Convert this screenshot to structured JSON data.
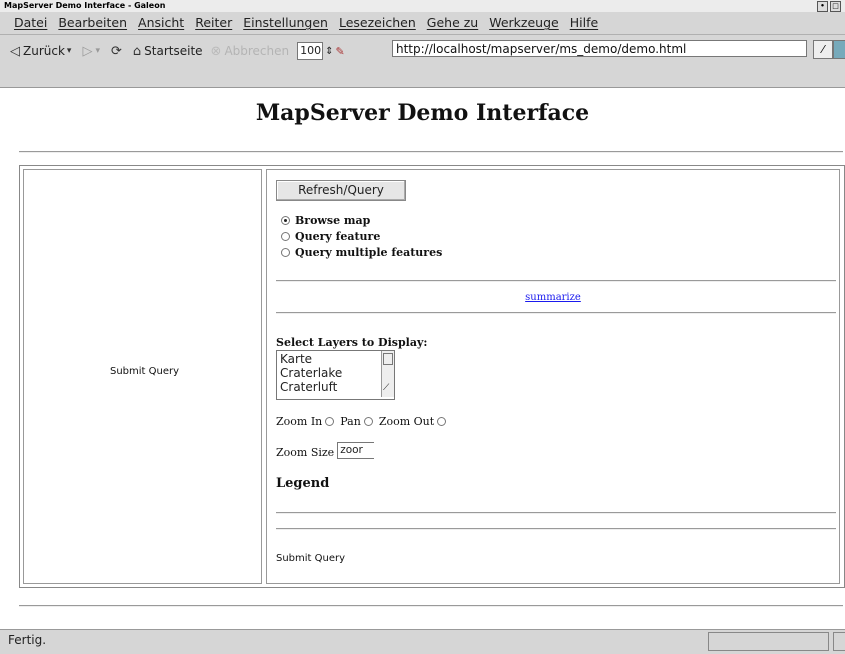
{
  "window": {
    "title": "MapServer Demo Interface - Galeon"
  },
  "menu": {
    "items": [
      "Datei",
      "Bearbeiten",
      "Ansicht",
      "Reiter",
      "Einstellungen",
      "Lesezeichen",
      "Gehe zu",
      "Werkzeuge",
      "Hilfe"
    ]
  },
  "toolbar": {
    "back_label": "Zurück",
    "home_label": "Startseite",
    "stop_label": "Abbrechen",
    "zoom_value": "100",
    "url": "http://localhost/mapserver/ms_demo/demo.html"
  },
  "page": {
    "heading": "MapServer Demo Interface",
    "left_submit": "Submit Query",
    "refresh_button": "Refresh/Query",
    "modes": [
      "Browse map",
      "Query feature",
      "Query multiple features"
    ],
    "selected_mode": "Browse map",
    "summarize_link": "summarize",
    "select_layers_label": "Select Layers to Display:",
    "layers": [
      "Karte",
      "Craterlake",
      "Craterluft"
    ],
    "zoom_in_label": "Zoom In",
    "pan_label": "Pan",
    "zoom_out_label": "Zoom Out",
    "zoom_size_label": "Zoom Size",
    "zoom_size_value": "zoor",
    "legend_label": "Legend",
    "right_submit": "Submit Query"
  },
  "status": {
    "text": "Fertig."
  }
}
